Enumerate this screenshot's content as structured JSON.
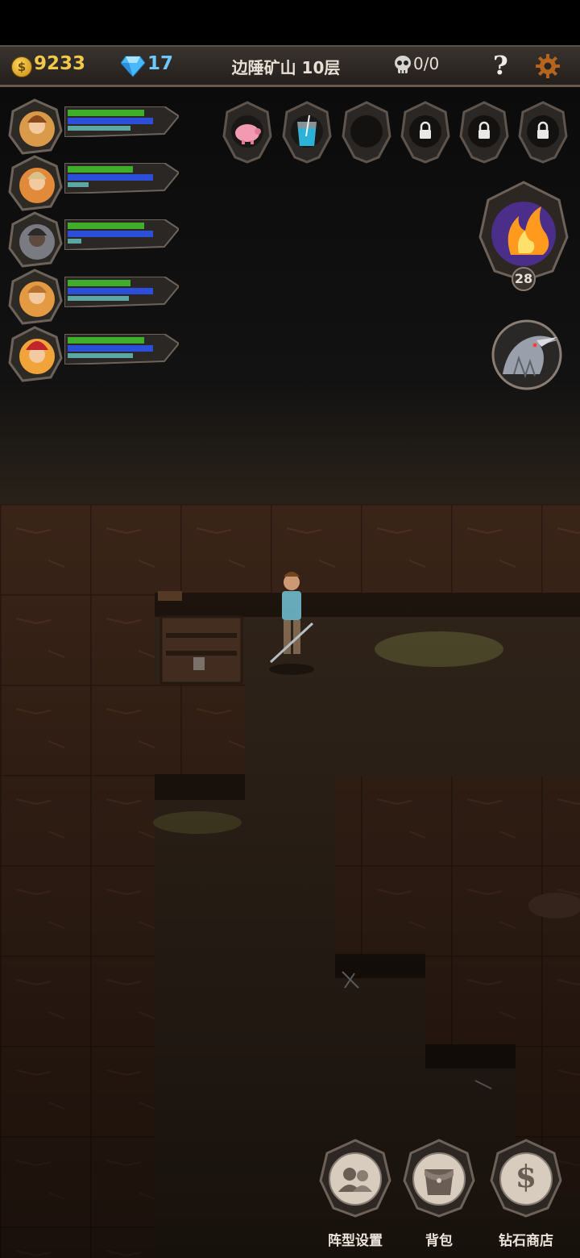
{
  "header": {
    "gold": "9233",
    "diamonds": "17",
    "location": "边陲矿山 10层",
    "kills": "0/0",
    "help_label": "?",
    "coin_symbol": "$"
  },
  "party": [
    {
      "hp": 0.85,
      "mp": 0.95,
      "exp": 0.7
    },
    {
      "hp": 0.72,
      "mp": 0.95,
      "exp": 0.23
    },
    {
      "hp": 0.85,
      "mp": 0.95,
      "exp": 0.15
    },
    {
      "hp": 0.7,
      "mp": 0.95,
      "exp": 0.68
    },
    {
      "hp": 0.85,
      "mp": 0.95,
      "exp": 0.72
    }
  ],
  "item_slots": [
    {
      "icon": "piggy-bank-icon",
      "state": "filled"
    },
    {
      "icon": "drink-icon",
      "state": "filled"
    },
    {
      "icon": "empty-slot",
      "state": "empty"
    },
    {
      "icon": "lock-icon",
      "state": "locked"
    },
    {
      "icon": "lock-icon",
      "state": "locked"
    },
    {
      "icon": "lock-icon",
      "state": "locked"
    }
  ],
  "skill": {
    "count": "28"
  },
  "menu": {
    "formation": "阵型设置",
    "bag": "背包",
    "shop": "钻石商店",
    "shop_symbol": "$"
  },
  "colors": {
    "hp": "#3fae2a",
    "mp": "#2b4fd8",
    "exp": "#5aa7a4",
    "gold": "#f2c84a",
    "diamond": "#6ec8ff"
  }
}
